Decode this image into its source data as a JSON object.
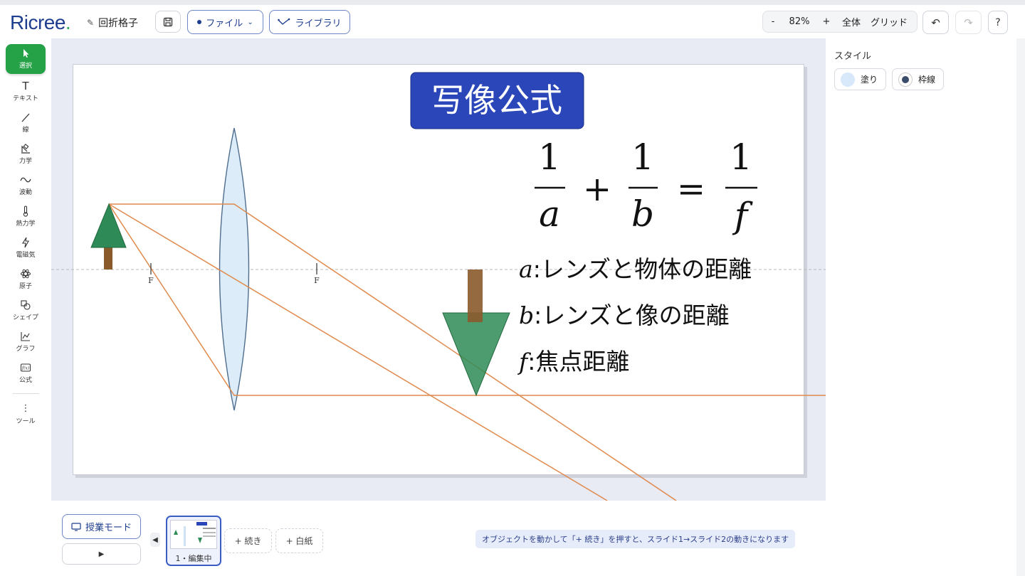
{
  "header": {
    "logo": "Ricree",
    "logo_dot": ".",
    "doc_title": "回折格子",
    "file_menu": "ファイル",
    "library": "ライブラリ",
    "zoom_minus": "-",
    "zoom_level": "82%",
    "zoom_plus": "+",
    "fit_all": "全体",
    "grid": "グリッド",
    "help": "?"
  },
  "tools": [
    {
      "label": "選択",
      "icon": "cursor-icon"
    },
    {
      "label": "テキスト",
      "icon": "text-icon"
    },
    {
      "label": "線",
      "icon": "line-icon"
    },
    {
      "label": "力学",
      "icon": "mechanics-icon"
    },
    {
      "label": "波動",
      "icon": "wave-icon"
    },
    {
      "label": "熱力学",
      "icon": "thermometer-icon"
    },
    {
      "label": "電磁気",
      "icon": "lightning-icon"
    },
    {
      "label": "原子",
      "icon": "atom-icon"
    },
    {
      "label": "シェイプ",
      "icon": "shapes-icon"
    },
    {
      "label": "グラフ",
      "icon": "graph-icon"
    },
    {
      "label": "公式",
      "icon": "formula-icon"
    },
    {
      "label": "ツール",
      "icon": "more-vertical-icon"
    }
  ],
  "slide": {
    "title": "写像公式",
    "formula": {
      "n1": "1",
      "d1": "a",
      "plus": "+",
      "n2": "1",
      "d2": "b",
      "eq": "=",
      "n3": "1",
      "d3": "f"
    },
    "defs": [
      {
        "sym": "a",
        "text": ":レンズと物体の距離"
      },
      {
        "sym": "b",
        "text": ":レンズと像の距離"
      },
      {
        "sym": "f",
        "text": ":焦点距離"
      }
    ],
    "focus_left": "F",
    "focus_right": "F"
  },
  "style_panel": {
    "label": "スタイル",
    "fill": "塗り",
    "stroke": "枠線"
  },
  "bottom": {
    "lesson_mode": "授業モード",
    "play": "▶",
    "thumb_label": "1・編集中",
    "continue_btn": "+ 続き",
    "blank_btn": "+ 白紙",
    "hint": "オブジェクトを動かして「+ 続き」を押すと、スライド1→スライド2の動きになります"
  },
  "colors": {
    "accent_green": "#25a147",
    "title_blue": "#2b46b8",
    "ray_orange": "#e08a4e",
    "tree_green": "#2e8b57",
    "trunk_brown": "#8b5a2b",
    "lens_fill": "#dcecf9"
  }
}
